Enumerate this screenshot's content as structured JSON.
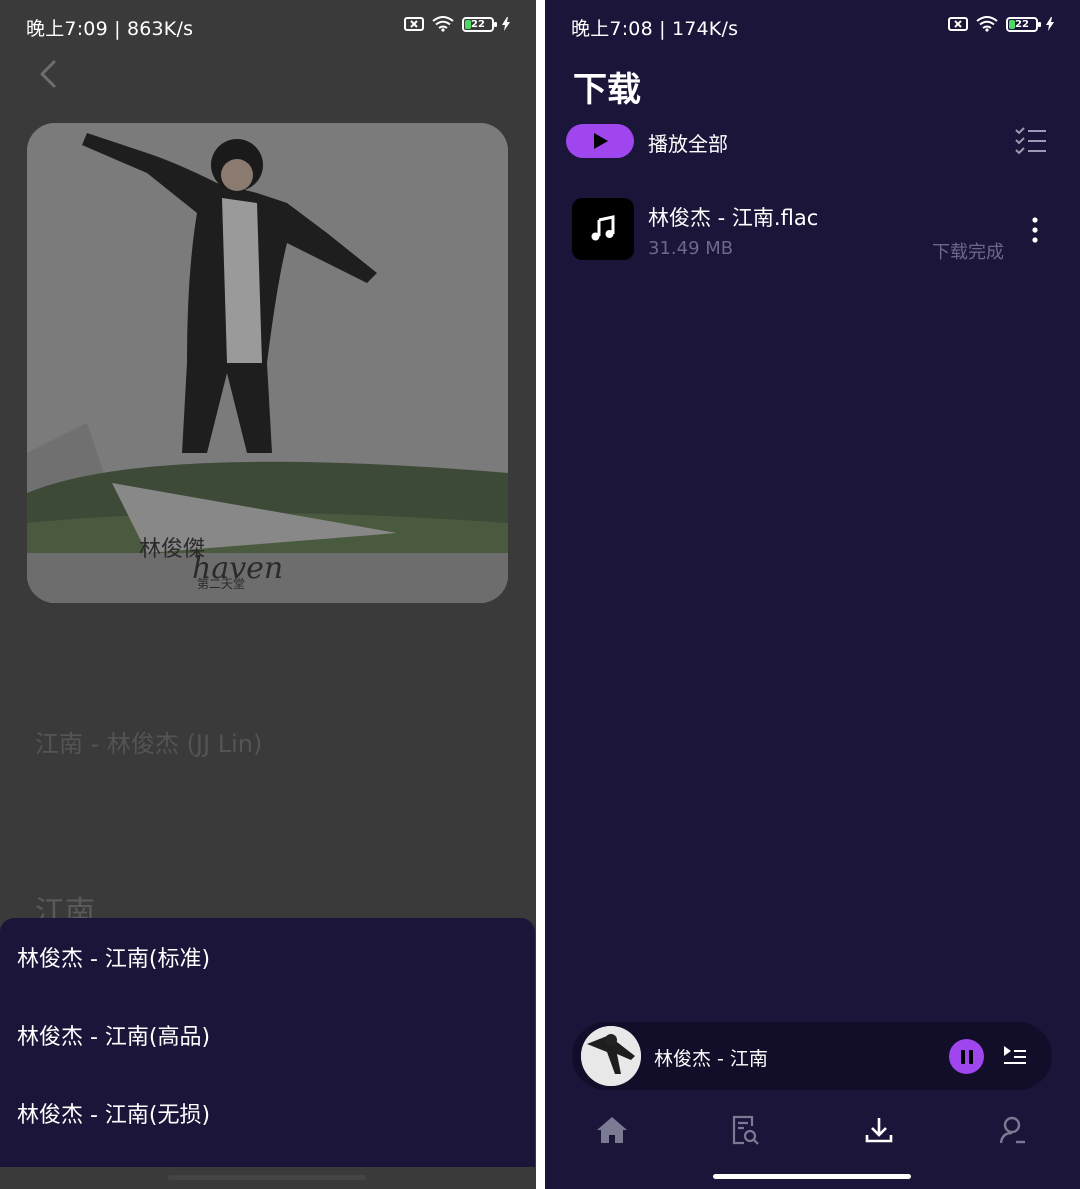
{
  "left": {
    "status": {
      "time": "晚上7:09 | 863K/s",
      "battery": "22"
    },
    "album": {
      "artist_text": "林俊傑",
      "album_text": "haven",
      "subtitle_text": "第二天堂"
    },
    "lyric_line": "江南 - 林俊杰 (JJ Lin)",
    "song_title": "江南",
    "quality_sheet": [
      {
        "label": "林俊杰 - 江南(标准)"
      },
      {
        "label": "林俊杰 - 江南(高品)"
      },
      {
        "label": "林俊杰 - 江南(无损)"
      }
    ]
  },
  "right": {
    "status": {
      "time": "晚上7:08 | 174K/s",
      "battery": "22"
    },
    "title": "下载",
    "play_all_label": "播放全部",
    "downloads": [
      {
        "name": "林俊杰 - 江南.flac",
        "size": "31.49 MB",
        "status": "下载完成"
      }
    ],
    "mini_player": {
      "title": "林俊杰 - 江南"
    },
    "nav": [
      {
        "icon": "home-icon",
        "active": false
      },
      {
        "icon": "search-list-icon",
        "active": false
      },
      {
        "icon": "download-icon",
        "active": true
      },
      {
        "icon": "user-icon",
        "active": false
      }
    ]
  },
  "colors": {
    "accent": "#9f46ef",
    "panel": "#1b1539",
    "overlay": "#3a3a3a"
  }
}
